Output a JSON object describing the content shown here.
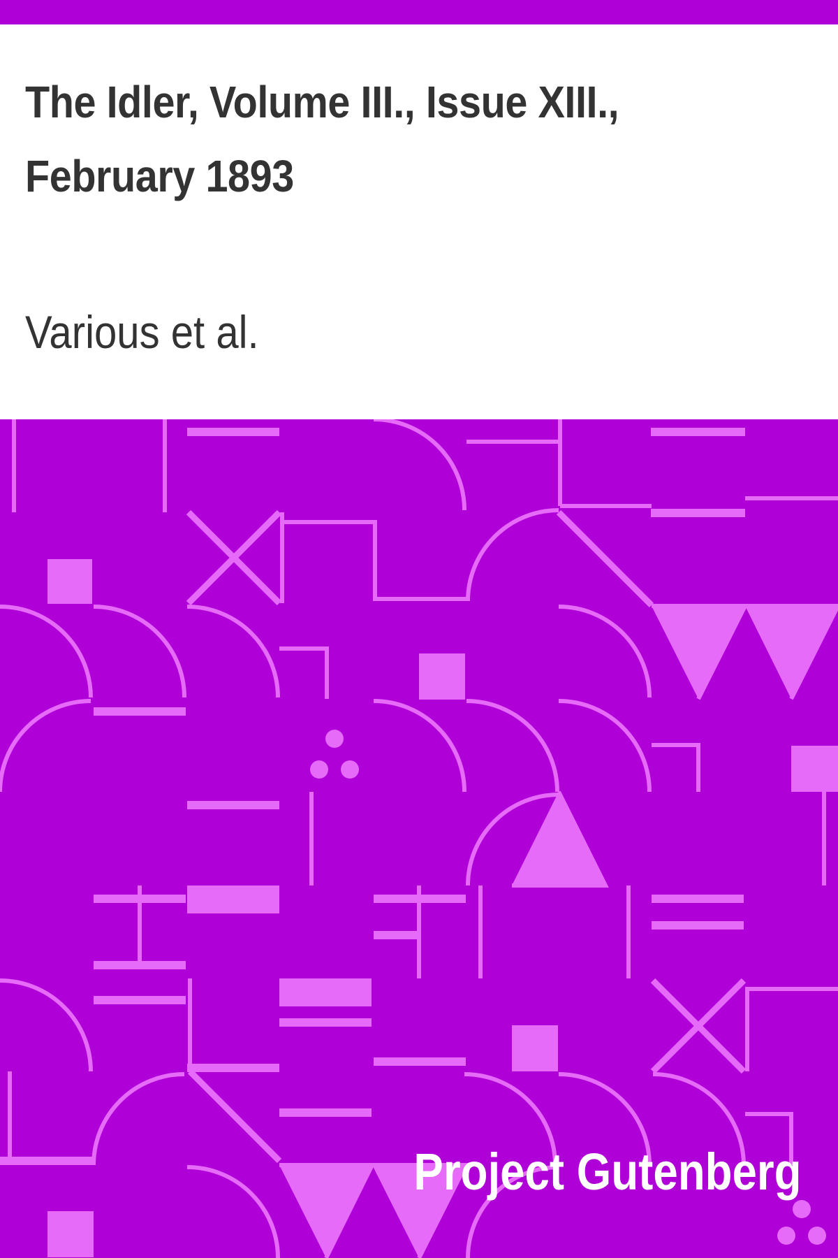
{
  "cover": {
    "title": "The Idler, Volume III., Issue XIII., February 1893",
    "author": "Various et al.",
    "publisher": "Project Gutenberg"
  },
  "colors": {
    "background": "#b000d8",
    "pattern": "#e56bf8",
    "panel": "#ffffff",
    "title_text": "#333333",
    "author_text": "#333333",
    "publisher_text": "#ffffff"
  }
}
